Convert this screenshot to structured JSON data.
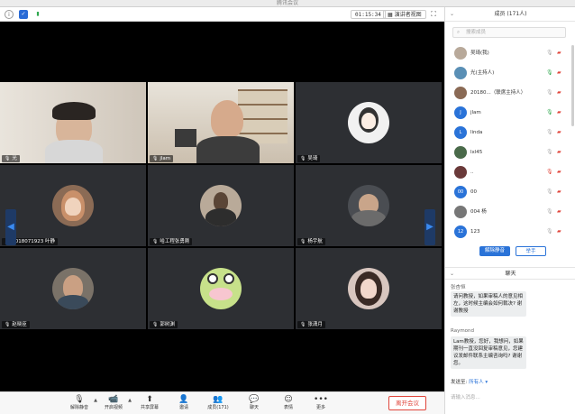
{
  "window": {
    "title": "腾讯会议"
  },
  "toolbar": {
    "timer": "01:15:34",
    "speaker_view": "演讲者视图"
  },
  "tiles": [
    {
      "name": "光"
    },
    {
      "name": "jlam"
    },
    {
      "name": "吴琦"
    },
    {
      "name": "2018071923 叶静"
    },
    {
      "name": "哈工程张勇刚"
    },
    {
      "name": "杨宇航"
    },
    {
      "name": "赵晓臣"
    },
    {
      "name": "郭树渊"
    },
    {
      "name": "张潇月"
    }
  ],
  "bottom": {
    "unmute": "解除静音",
    "video": "开启视频",
    "share": "共享屏幕",
    "invite": "邀请",
    "members": "成员(171)",
    "chat": "聊天",
    "emoji": "表情",
    "more": "更多",
    "leave": "离开会议"
  },
  "members_panel": {
    "title": "成员 (171人)",
    "search_placeholder": "搜索成员",
    "items": [
      {
        "name": "吴琦(我)",
        "color": "#b8a99a"
      },
      {
        "name": "光(主持人)",
        "color": "#5a8fb5"
      },
      {
        "name": "20180...（联席主持人）",
        "color": "#8a6a55"
      },
      {
        "name": "jlam",
        "avatar": "J",
        "color": "#2a73d8"
      },
      {
        "name": "linda",
        "avatar": "L",
        "color": "#2a73d8"
      },
      {
        "name": "lxl45",
        "color": "#4a6a4a"
      },
      {
        "name": "..",
        "color": "#6a3a3a"
      },
      {
        "name": "00",
        "avatar": "00",
        "color": "#2a73d8"
      },
      {
        "name": "004 杨",
        "color": "#777777"
      },
      {
        "name": "123",
        "avatar": "12",
        "color": "#2a73d8"
      }
    ],
    "unmute_all": "解除静音",
    "raise_hand": "举手"
  },
  "chat": {
    "title": "聊天",
    "messages": [
      {
        "sender": "张杏恒",
        "text": "请问教授，如果审稿人的意见相左，这时候主编会如何裁决? 谢谢教授"
      },
      {
        "sender": "Raymond",
        "text": "Lam教授，您好，我想问，如果期刊一直没回复审稿意见，您建议发邮件联系主编咨询吗? 谢谢您。"
      }
    ],
    "send_to_label": "发送至:",
    "send_to_value": "所有人",
    "input_placeholder": "请输入消息..."
  }
}
